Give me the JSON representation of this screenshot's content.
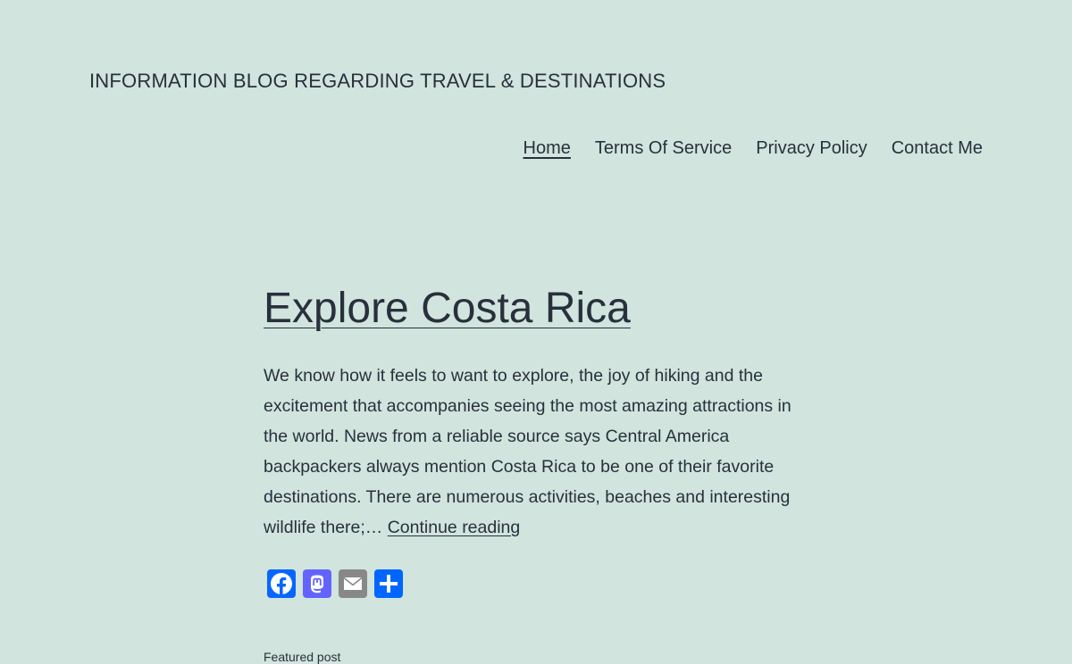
{
  "site": {
    "title": "INFORMATION BLOG REGARDING TRAVEL & DESTINATIONS"
  },
  "nav": {
    "items": [
      {
        "label": "Home",
        "current": true
      },
      {
        "label": "Terms Of Service",
        "current": false
      },
      {
        "label": "Privacy Policy",
        "current": false
      },
      {
        "label": "Contact Me",
        "current": false
      }
    ]
  },
  "post": {
    "title": "Explore Costa Rica",
    "excerpt": "We know how it feels to want to explore, the joy of hiking and the excitement that accompanies seeing the most amazing attractions in the world. News from a reliable source says Central America backpackers always mention Costa Rica to be one of their favorite destinations. There are numerous activities, beaches and interesting wildlife there;… ",
    "continue_label": "Continue reading",
    "meta": "Featured post"
  },
  "share": {
    "buttons": [
      {
        "icon": "facebook-icon",
        "color": "#0866ff"
      },
      {
        "icon": "mastodon-icon",
        "color": "#6364ff"
      },
      {
        "icon": "email-icon",
        "color": "#888888"
      },
      {
        "icon": "share-icon",
        "color": "#0166ff"
      }
    ]
  },
  "colors": {
    "background": "#d1e4dd",
    "text": "#28303d"
  }
}
